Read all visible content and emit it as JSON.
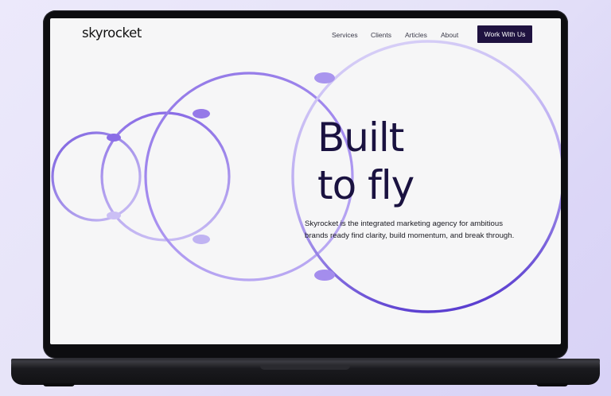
{
  "site": {
    "brand": "skyrocket",
    "nav": [
      {
        "label": "Services"
      },
      {
        "label": "Clients"
      },
      {
        "label": "Articles"
      },
      {
        "label": "About"
      }
    ],
    "cta_label": "Work With Us"
  },
  "hero": {
    "headline_line1": "Built",
    "headline_line2": "to fly",
    "subtext": "Skyrocket is the integrated marketing agency for ambitious brands ready find clarity, build momentum, and break through."
  },
  "colors": {
    "accent": "#6a4fd6",
    "cta_bg": "#1f1240",
    "headline": "#1a1240",
    "ring_light": "#d3caf6"
  }
}
